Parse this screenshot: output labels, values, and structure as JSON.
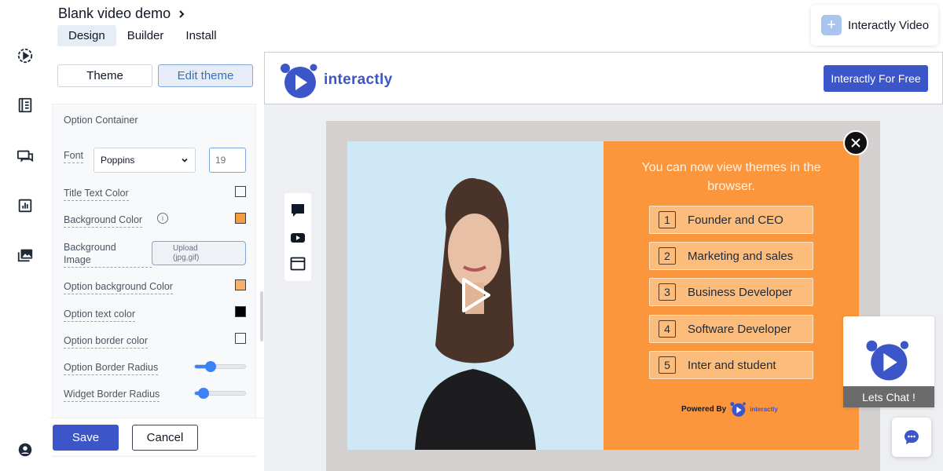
{
  "header": {
    "title": "Blank video demo",
    "tabs": [
      {
        "label": "Design",
        "active": true
      },
      {
        "label": "Builder",
        "active": false
      },
      {
        "label": "Install",
        "active": false
      }
    ],
    "brand_button": "Interactly Video"
  },
  "sidebar": {
    "icons": [
      "video-play-icon",
      "page-icon",
      "chat-icon",
      "analytics-icon",
      "media-icon",
      "account-icon"
    ]
  },
  "panel": {
    "theme_tab": "Theme",
    "edit_tab": "Edit theme",
    "section_title": "Option Container",
    "font_label": "Font",
    "font_value": "Poppins",
    "font_size": "19",
    "title_text_color_label": "Title Text Color",
    "background_color_label": "Background Color",
    "background_image_label_1": "Background",
    "background_image_label_2": "Image",
    "upload_label_1": "Upload",
    "upload_label_2": "(jpg,gif)",
    "option_bg_color_label": "Option background Color",
    "option_text_color_label": "Option text color",
    "option_border_color_label": "Option border color",
    "option_border_radius_label": "Option Border Radius",
    "option_border_radius_level": 0.32,
    "widget_border_radius_label": "Widget Border Radius",
    "widget_border_radius_level": 0.17,
    "colors": {
      "title_text": "#ffffff",
      "background": "#f59a3f",
      "option_background": "#f8b06c",
      "option_text": "#000000",
      "option_border": "#ffffff"
    },
    "save_label": "Save",
    "cancel_label": "Cancel"
  },
  "preview": {
    "logo_word": "interactly",
    "free_button": "Interactly For Free",
    "question": "You can now view themes in the browser.",
    "options": [
      {
        "num": "1",
        "text": "Founder and CEO"
      },
      {
        "num": "2",
        "text": "Marketing and sales"
      },
      {
        "num": "3",
        "text": "Business Developer"
      },
      {
        "num": "4",
        "text": "Software Developer"
      },
      {
        "num": "5",
        "text": "Inter and student"
      }
    ],
    "powered_by": "Powered By",
    "powered_word": "interactly",
    "chat_label": "Lets Chat !"
  }
}
